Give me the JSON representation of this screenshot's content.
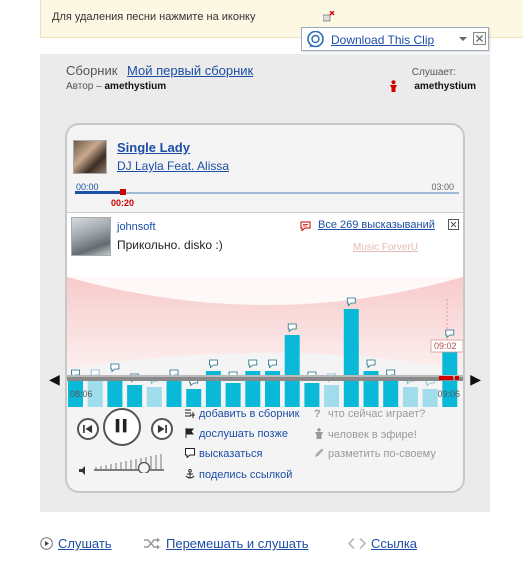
{
  "notice": {
    "text": "Для удаления песни нажмите на иконку"
  },
  "download_popup": {
    "label": "Download This Clip"
  },
  "compilation": {
    "label": "Сборник",
    "name": "Мой первый сборник",
    "author_label": "Автор –",
    "author": "amethystium",
    "listening_label": "Слушает:",
    "listener": "amethystium"
  },
  "track": {
    "title": "Single Lady",
    "artist": "DJ Layla Feat. Alissa",
    "time_start": "00:00",
    "time_end": "03:00",
    "time_current": "00:20",
    "progress": 0.11
  },
  "comment": {
    "user": "johnsoft",
    "text": "Прикольно. disko :)",
    "all_comments": "Все 269 высказываний",
    "music_link": "Music ForverU"
  },
  "timeline": {
    "time_left": "08:06",
    "time_right": "09:06",
    "marker": "09:02",
    "bars": [
      {
        "value": 26,
        "bubble": true,
        "light": false
      },
      {
        "value": 26,
        "bubble": true,
        "light": true
      },
      {
        "value": 32,
        "bubble": true,
        "light": false
      },
      {
        "value": 22,
        "bubble": true,
        "light": false
      },
      {
        "value": 20,
        "bubble": true,
        "light": true
      },
      {
        "value": 26,
        "bubble": true,
        "light": false
      },
      {
        "value": 18,
        "bubble": true,
        "light": false
      },
      {
        "value": 36,
        "bubble": true,
        "light": false
      },
      {
        "value": 24,
        "bubble": true,
        "light": false
      },
      {
        "value": 36,
        "bubble": true,
        "light": false
      },
      {
        "value": 36,
        "bubble": true,
        "light": false
      },
      {
        "value": 72,
        "bubble": true,
        "light": false
      },
      {
        "value": 24,
        "bubble": true,
        "light": false
      },
      {
        "value": 22,
        "bubble": true,
        "light": true
      },
      {
        "value": 98,
        "bubble": true,
        "light": false
      },
      {
        "value": 36,
        "bubble": true,
        "light": false
      },
      {
        "value": 26,
        "bubble": true,
        "light": false
      },
      {
        "value": 20,
        "bubble": true,
        "light": true
      },
      {
        "value": 18,
        "bubble": true,
        "light": true
      },
      {
        "value": 66,
        "bubble": true,
        "light": false
      }
    ]
  },
  "actions": {
    "add": "добавить в сборник",
    "later": "дослушать позже",
    "say": "высказаться",
    "share": "поделись ссылкой",
    "now_playing": "что сейчас играет?",
    "on_air": "человек в эфире!",
    "markup": "разметить по-своему"
  },
  "bottom": {
    "listen": "Слушать",
    "shuffle": "Перемешать и слушать",
    "link": "Ссылка"
  },
  "colors": {
    "bar": "#0ab9d8",
    "bar_light": "#9fdcec",
    "link": "#1c4ea5",
    "accent_red": "#d10000"
  }
}
